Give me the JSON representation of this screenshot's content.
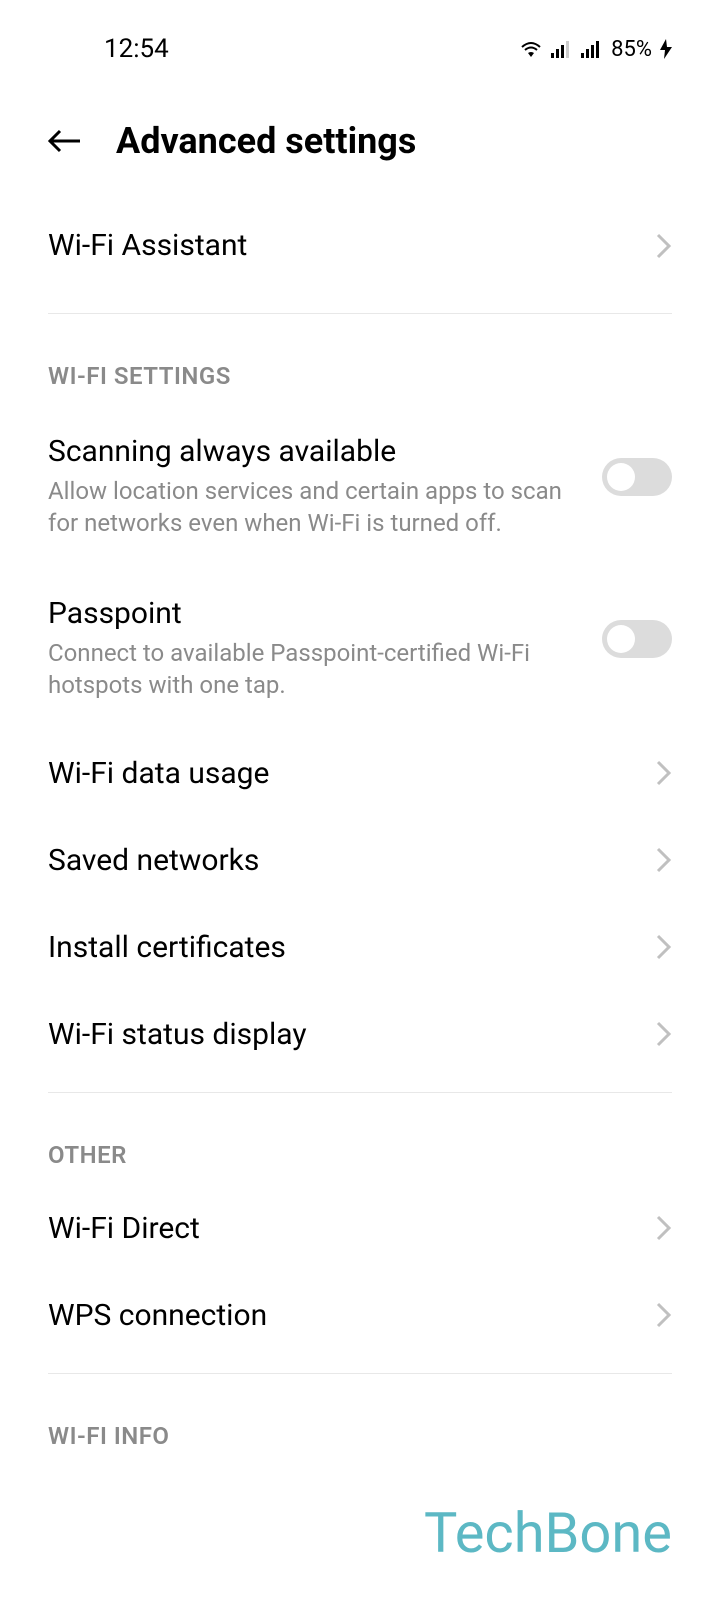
{
  "status_bar": {
    "time": "12:54",
    "battery": "85%"
  },
  "header": {
    "title": "Advanced settings"
  },
  "top_item": {
    "title": "Wi-Fi Assistant"
  },
  "sections": {
    "wifi_settings": {
      "header": "WI-FI SETTINGS",
      "items": {
        "scanning": {
          "title": "Scanning always available",
          "subtitle": "Allow location services and certain apps to scan for networks even when Wi-Fi is turned off."
        },
        "passpoint": {
          "title": "Passpoint",
          "subtitle": "Connect to available Passpoint-certified Wi-Fi hotspots with one tap."
        },
        "data_usage": {
          "title": "Wi-Fi data usage"
        },
        "saved_networks": {
          "title": "Saved networks"
        },
        "install_certificates": {
          "title": "Install certificates"
        },
        "status_display": {
          "title": "Wi-Fi status display"
        }
      }
    },
    "other": {
      "header": "OTHER",
      "items": {
        "wifi_direct": {
          "title": "Wi-Fi Direct"
        },
        "wps": {
          "title": "WPS connection"
        }
      }
    },
    "wifi_info": {
      "header": "WI-FI INFO"
    }
  },
  "watermark": "TechBone"
}
